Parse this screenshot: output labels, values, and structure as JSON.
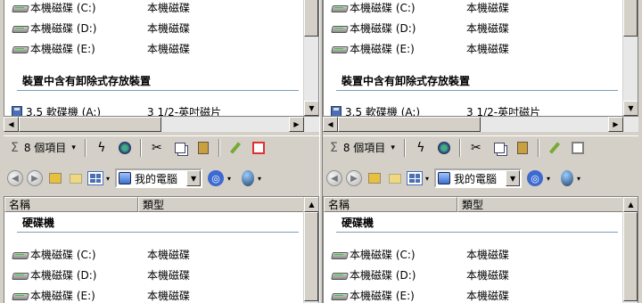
{
  "panes": [
    {
      "id": "left",
      "drives": [
        {
          "name": "本機磁碟 (C:)",
          "type": "本機磁碟"
        },
        {
          "name": "本機磁碟 (D:)",
          "type": "本機磁碟"
        },
        {
          "name": "本機磁碟 (E:)",
          "type": "本機磁碟"
        }
      ],
      "removable_group": "裝置中含有卸除式存放裝置",
      "floppy": {
        "name": "3.5 軟碟機 (A:)",
        "type": "3 1/2-英吋磁片"
      },
      "status": {
        "count": "8 個項目"
      },
      "address": "我的電腦",
      "columns": {
        "name": "名稱",
        "type": "類型"
      },
      "hard_disk_group": "硬碟機",
      "bottom_drives": [
        {
          "name": "本機磁碟 (C:)",
          "type": "本機磁碟"
        },
        {
          "name": "本機磁碟 (D:)",
          "type": "本機磁碟"
        },
        {
          "name": "本機磁碟 (E:)",
          "type": "本機磁碟"
        }
      ],
      "active_button_color": "#e03030"
    },
    {
      "id": "right",
      "drives": [
        {
          "name": "本機磁碟 (C:)",
          "type": "本機磁碟"
        },
        {
          "name": "本機磁碟 (D:)",
          "type": "本機磁碟"
        },
        {
          "name": "本機磁碟 (E:)",
          "type": "本機磁碟"
        }
      ],
      "removable_group": "裝置中含有卸除式存放裝置",
      "floppy": {
        "name": "3.5 軟碟機 (A:)",
        "type": "3 1/2-英吋磁片"
      },
      "status": {
        "count": "8 個項目"
      },
      "address": "我的電腦",
      "columns": {
        "name": "名稱",
        "type": "類型"
      },
      "hard_disk_group": "硬碟機",
      "bottom_drives": [
        {
          "name": "本機磁碟 (C:)",
          "type": "本機磁碟"
        },
        {
          "name": "本機磁碟 (D:)",
          "type": "本機磁碟"
        },
        {
          "name": "本機磁碟 (E:)",
          "type": "本機磁碟"
        }
      ],
      "active_button_color": "#808080"
    }
  ],
  "icons": {
    "sigma": "Σ",
    "arrow_down": "▾",
    "refresh": "ϟ",
    "cut": "✂",
    "up_arrow": "▲",
    "down_arrow": "▼",
    "left_arrow": "◀",
    "right_arrow": "▶"
  }
}
